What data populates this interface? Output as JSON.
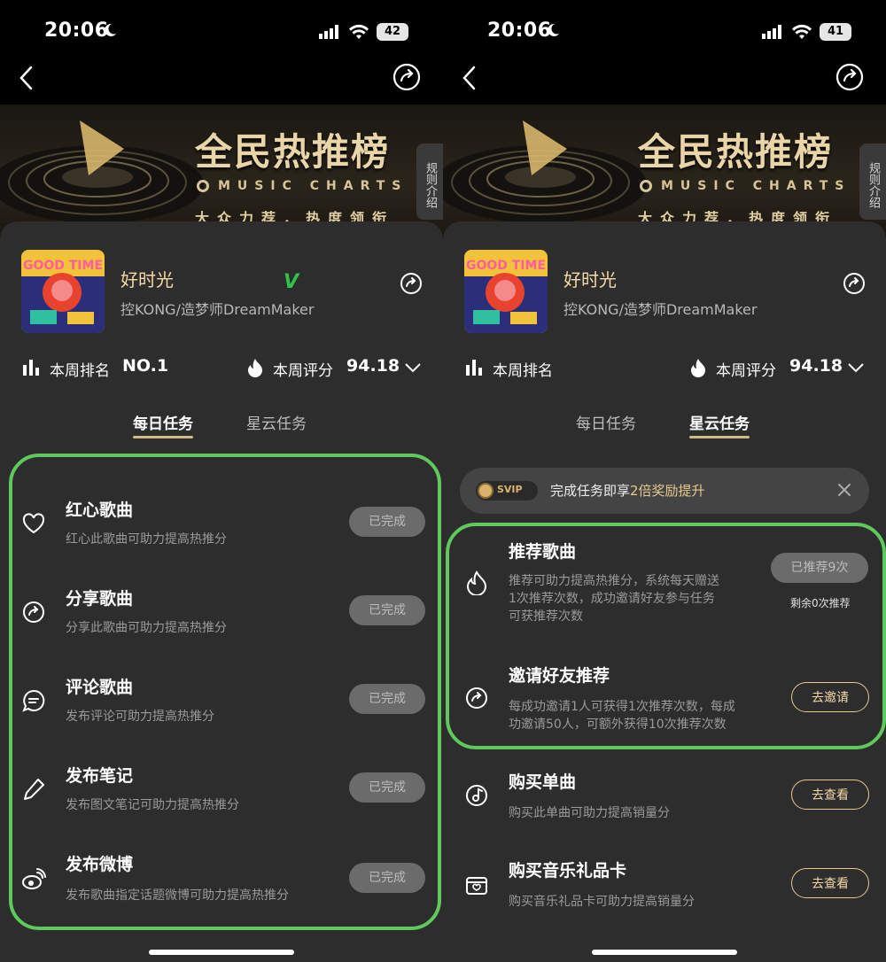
{
  "status": {
    "left_time": "20:06",
    "left_battery": "42",
    "right_time": "20:06",
    "right_battery": "41"
  },
  "banner": {
    "title": "全民热推榜",
    "subtitle": "MUSIC CHARTS",
    "tagline": "大众力荐，热度领衔",
    "rules_label": "规则介绍"
  },
  "song": {
    "title": "好时光",
    "artist": "控KONG/造梦师DreamMaker",
    "check_mark": "V"
  },
  "stats": {
    "rank_label": "本周排名",
    "rank_value": "NO.1",
    "score_label": "本周评分",
    "score_value": "94.18"
  },
  "tabs": {
    "daily": "每日任务",
    "nebula": "星云任务"
  },
  "left_tasks": [
    {
      "icon": "heart-icon",
      "title": "红心歌曲",
      "desc": "红心此歌曲可助力提高热推分",
      "button": "已完成"
    },
    {
      "icon": "share-icon",
      "title": "分享歌曲",
      "desc": "分享此歌曲可助力提高热推分",
      "button": "已完成"
    },
    {
      "icon": "comment-icon",
      "title": "评论歌曲",
      "desc": "发布评论可助力提高热推分",
      "button": "已完成"
    },
    {
      "icon": "pencil-icon",
      "title": "发布笔记",
      "desc": "发布图文笔记可助力提高热推分",
      "button": "已完成"
    },
    {
      "icon": "weibo-icon",
      "title": "发布微博",
      "desc": "发布歌曲指定话题微博可助力提高热推分",
      "button": "已完成"
    }
  ],
  "promo": {
    "badge": "SVIP",
    "text_prefix": "完成任务即享",
    "text_highlight": "2倍奖励提升"
  },
  "right_tasks": [
    {
      "icon": "fire-icon",
      "title": "推荐歌曲",
      "desc_line1": "推荐可助力提高热推分，系统每天赠送",
      "desc_line2": "1次推荐次数，成功邀请好友参与任务",
      "desc_line3": "可获推荐次数",
      "button": "已推荐9次",
      "remain": "剩余0次推荐"
    },
    {
      "icon": "share-icon",
      "title": "邀请好友推荐",
      "desc_line1": "每成功邀请1人可获得1次推荐次数，每成",
      "desc_line2": "功邀请50人，可额外获得10次推荐次数",
      "button": "去邀请"
    },
    {
      "icon": "disc-icon",
      "title": "购买单曲",
      "desc_line1": "购买此单曲可助力提高销量分",
      "button": "去查看"
    },
    {
      "icon": "gift-card-icon",
      "title": "购买音乐礼品卡",
      "desc_line1": "购买音乐礼品卡可助力提高销量分",
      "button": "去查看"
    }
  ]
}
